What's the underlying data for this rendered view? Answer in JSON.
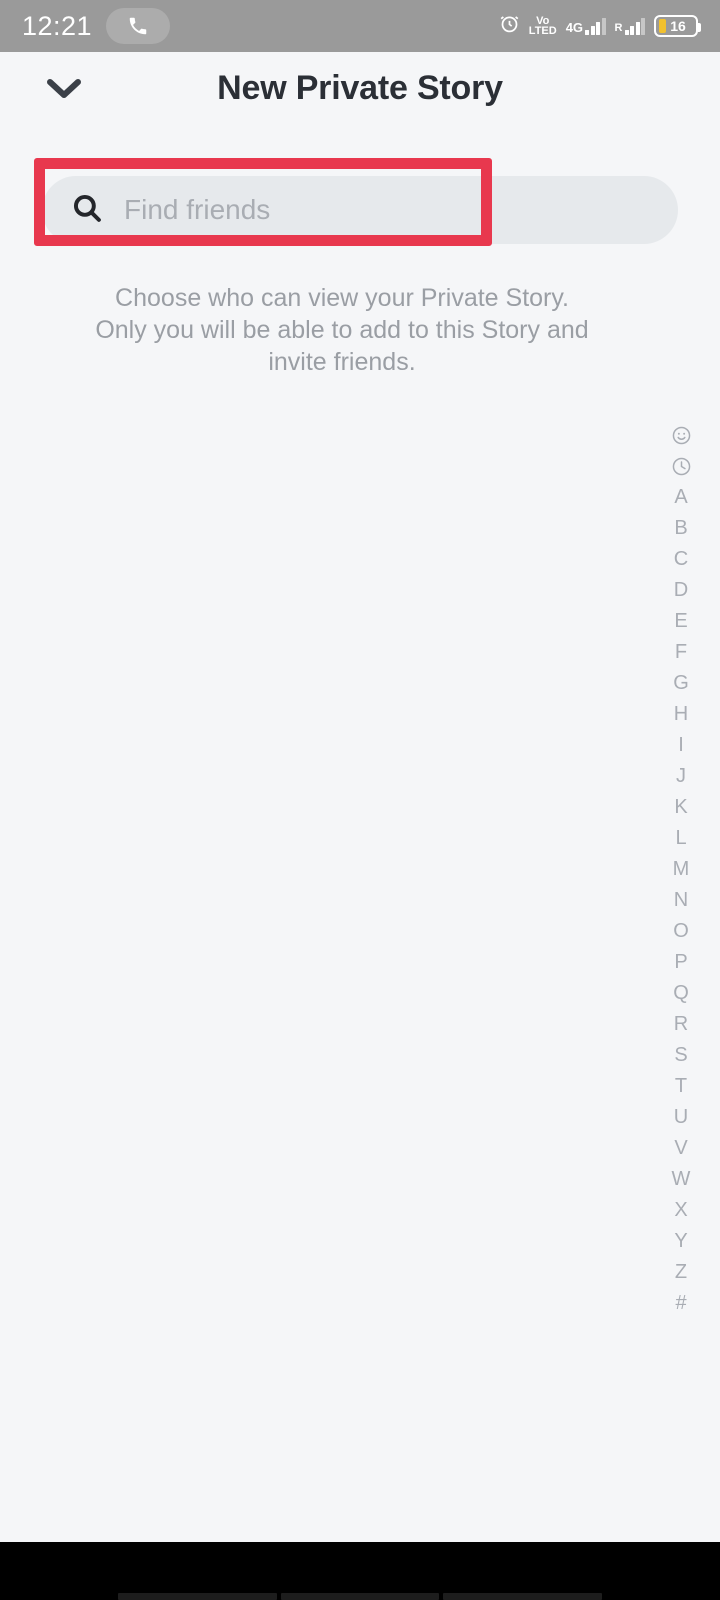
{
  "statusbar": {
    "time": "12:21",
    "call_icon": "phone-icon",
    "alarm_icon": "alarm-clock-icon",
    "volte_line1": "Vo",
    "volte_line2": "LTED",
    "network_label": "4G",
    "roaming_label": "R",
    "battery_level": "16"
  },
  "header": {
    "back_icon": "chevron-down-icon",
    "title": "New Private Story"
  },
  "search": {
    "icon": "search-icon",
    "value": "",
    "placeholder": "Find friends"
  },
  "annotation": {
    "color": "#e8384e"
  },
  "description": {
    "line1": "Choose who can view your Private Story.",
    "line2": "Only you will be able to add to this Story and",
    "line3": "invite friends."
  },
  "alpha_index": {
    "items": [
      {
        "label": "",
        "icon": "smiley-face-icon"
      },
      {
        "label": "",
        "icon": "clock-icon"
      },
      {
        "label": "A",
        "icon": ""
      },
      {
        "label": "B",
        "icon": ""
      },
      {
        "label": "C",
        "icon": ""
      },
      {
        "label": "D",
        "icon": ""
      },
      {
        "label": "E",
        "icon": ""
      },
      {
        "label": "F",
        "icon": ""
      },
      {
        "label": "G",
        "icon": ""
      },
      {
        "label": "H",
        "icon": ""
      },
      {
        "label": "I",
        "icon": ""
      },
      {
        "label": "J",
        "icon": ""
      },
      {
        "label": "K",
        "icon": ""
      },
      {
        "label": "L",
        "icon": ""
      },
      {
        "label": "M",
        "icon": ""
      },
      {
        "label": "N",
        "icon": ""
      },
      {
        "label": "O",
        "icon": ""
      },
      {
        "label": "P",
        "icon": ""
      },
      {
        "label": "Q",
        "icon": ""
      },
      {
        "label": "R",
        "icon": ""
      },
      {
        "label": "S",
        "icon": ""
      },
      {
        "label": "T",
        "icon": ""
      },
      {
        "label": "U",
        "icon": ""
      },
      {
        "label": "V",
        "icon": ""
      },
      {
        "label": "W",
        "icon": ""
      },
      {
        "label": "X",
        "icon": ""
      },
      {
        "label": "Y",
        "icon": ""
      },
      {
        "label": "Z",
        "icon": ""
      },
      {
        "label": "#",
        "icon": ""
      }
    ]
  },
  "navbar": {
    "recents_icon": "recents-nav-icon",
    "home_icon": "home-nav-icon",
    "back_icon": "back-nav-icon"
  }
}
